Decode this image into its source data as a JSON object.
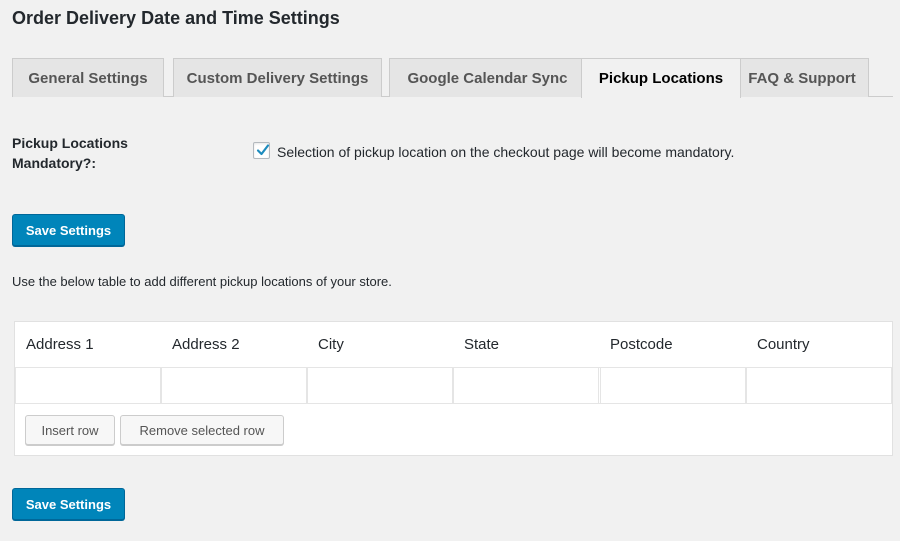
{
  "page": {
    "title": "Order Delivery Date and Time Settings"
  },
  "tabs": [
    {
      "label": "General Settings",
      "active": false
    },
    {
      "label": "Custom Delivery Settings",
      "active": false
    },
    {
      "label": "Google Calendar Sync",
      "active": false
    },
    {
      "label": "Pickup Locations",
      "active": true
    },
    {
      "label": "FAQ & Support",
      "active": false
    }
  ],
  "mandatory": {
    "label": "Pickup Locations Mandatory?:",
    "checked": true,
    "description": "Selection of pickup location on the checkout page will become mandatory."
  },
  "buttons": {
    "save_label": "Save Settings",
    "insert_row": "Insert row",
    "remove_row": "Remove selected row"
  },
  "intro_text": "Use the below table to add different pickup locations of your store.",
  "table": {
    "columns": [
      "Address 1",
      "Address 2",
      "City",
      "State",
      "Postcode",
      "Country"
    ],
    "rows": [
      [
        "",
        "",
        "",
        "",
        "",
        ""
      ]
    ]
  },
  "colors": {
    "primary": "#0085ba",
    "background": "#f1f1f1"
  }
}
